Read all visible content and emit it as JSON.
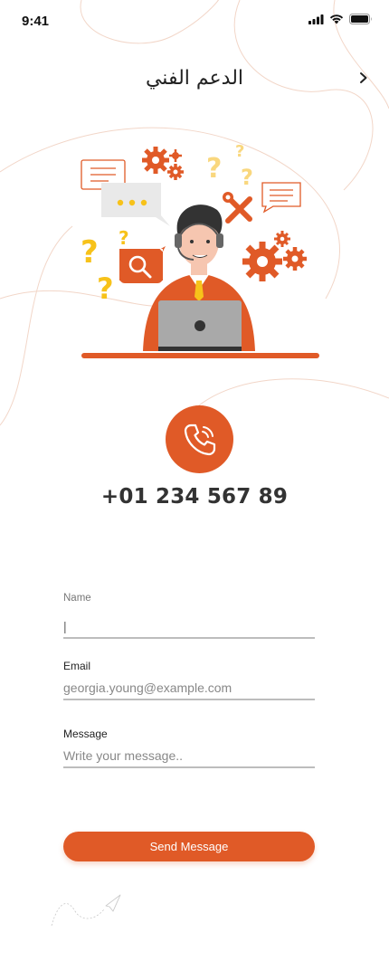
{
  "status_bar": {
    "time": "9:41"
  },
  "header": {
    "title": "الدعم الفني"
  },
  "contact": {
    "phone": "+01 234 567 89"
  },
  "form": {
    "name": {
      "label": "Name",
      "value": "|"
    },
    "email": {
      "label": "Email",
      "placeholder": "georgia.young@example.com"
    },
    "message": {
      "label": "Message",
      "placeholder": "Write your message.."
    },
    "submit_label": "Send Message"
  },
  "colors": {
    "accent": "#e05a27",
    "illustration_yellow": "#f7c21a",
    "divider": "#bdbdbd"
  }
}
